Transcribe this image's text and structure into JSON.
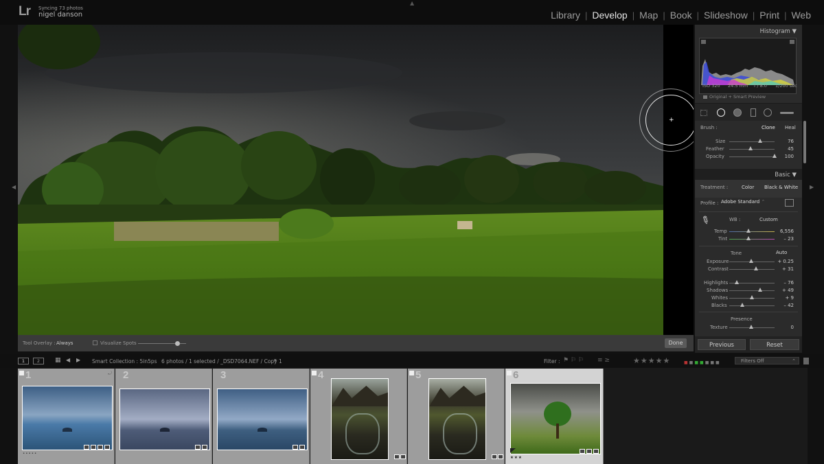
{
  "app": {
    "logo": "Lr",
    "sync_status": "Syncing 73 photos",
    "user_name": "nigel danson"
  },
  "modules": [
    {
      "label": "Library",
      "active": false
    },
    {
      "label": "Develop",
      "active": true
    },
    {
      "label": "Map",
      "active": false
    },
    {
      "label": "Book",
      "active": false
    },
    {
      "label": "Slideshow",
      "active": false
    },
    {
      "label": "Print",
      "active": false
    },
    {
      "label": "Web",
      "active": false
    }
  ],
  "toolbar": {
    "tool_overlay_label": "Tool Overlay :",
    "tool_overlay_value": "Always",
    "visualize_spots_label": "Visualize Spots",
    "done_label": "Done"
  },
  "histogram": {
    "title": "Histogram",
    "iso": "ISO 320",
    "focal_length": "24.5 mm",
    "aperture": "f / 8.0",
    "shutter": "1/200 sec",
    "preview_label": "Original + Smart Preview"
  },
  "spot_removal": {
    "brush_label": "Brush :",
    "clone_label": "Clone",
    "heal_label": "Heal",
    "size_label": "Size",
    "size_value": "76",
    "feather_label": "Feather",
    "feather_value": "45",
    "opacity_label": "Opacity",
    "opacity_value": "100"
  },
  "basic": {
    "title": "Basic",
    "treatment_label": "Treatment :",
    "color_label": "Color",
    "bw_label": "Black & White",
    "profile_label": "Profile :",
    "profile_value": "Adobe Standard",
    "wb_label": "WB :",
    "wb_value": "Custom",
    "temp_label": "Temp",
    "temp_value": "6,556",
    "tint_label": "Tint",
    "tint_value": "– 23",
    "tone_label": "Tone",
    "auto_label": "Auto",
    "exposure_label": "Exposure",
    "exposure_value": "+ 0.25",
    "contrast_label": "Contrast",
    "contrast_value": "+ 31",
    "highlights_label": "Highlights",
    "highlights_value": "– 76",
    "shadows_label": "Shadows",
    "shadows_value": "+ 49",
    "whites_label": "Whites",
    "whites_value": "+ 9",
    "blacks_label": "Blacks",
    "blacks_value": "– 42",
    "presence_label": "Presence",
    "texture_label": "Texture",
    "texture_value": "0"
  },
  "panel_buttons": {
    "previous_label": "Previous",
    "reset_label": "Reset"
  },
  "filmstrip_header": {
    "view1": "1",
    "view2": "2",
    "collection": "Smart Collection : 5in5ps",
    "selection_info": "6 photos / 1 selected / _DSD7064.NEF / Copy 1",
    "filter_label": "Filter :",
    "filters_off_label": "Filters Off",
    "stars": "★★★★★"
  },
  "filmstrip": [
    {
      "number": "1",
      "rating": "•••••",
      "selected": false,
      "flag": true
    },
    {
      "number": "2",
      "rating": "",
      "selected": false,
      "flag": false
    },
    {
      "number": "3",
      "rating": "",
      "selected": false,
      "flag": false
    },
    {
      "number": "4",
      "rating": "",
      "selected": false,
      "flag": true
    },
    {
      "number": "5",
      "rating": "",
      "selected": false,
      "flag": true
    },
    {
      "number": "6",
      "rating": "★★★",
      "selected": true,
      "flag": true
    }
  ],
  "colors": {
    "accent_text": "#e6e6e6",
    "panel_bg": "#2b2b2b",
    "filmstrip_cell": "#9d9d9d",
    "filmstrip_selected": "#d3d3d3"
  }
}
